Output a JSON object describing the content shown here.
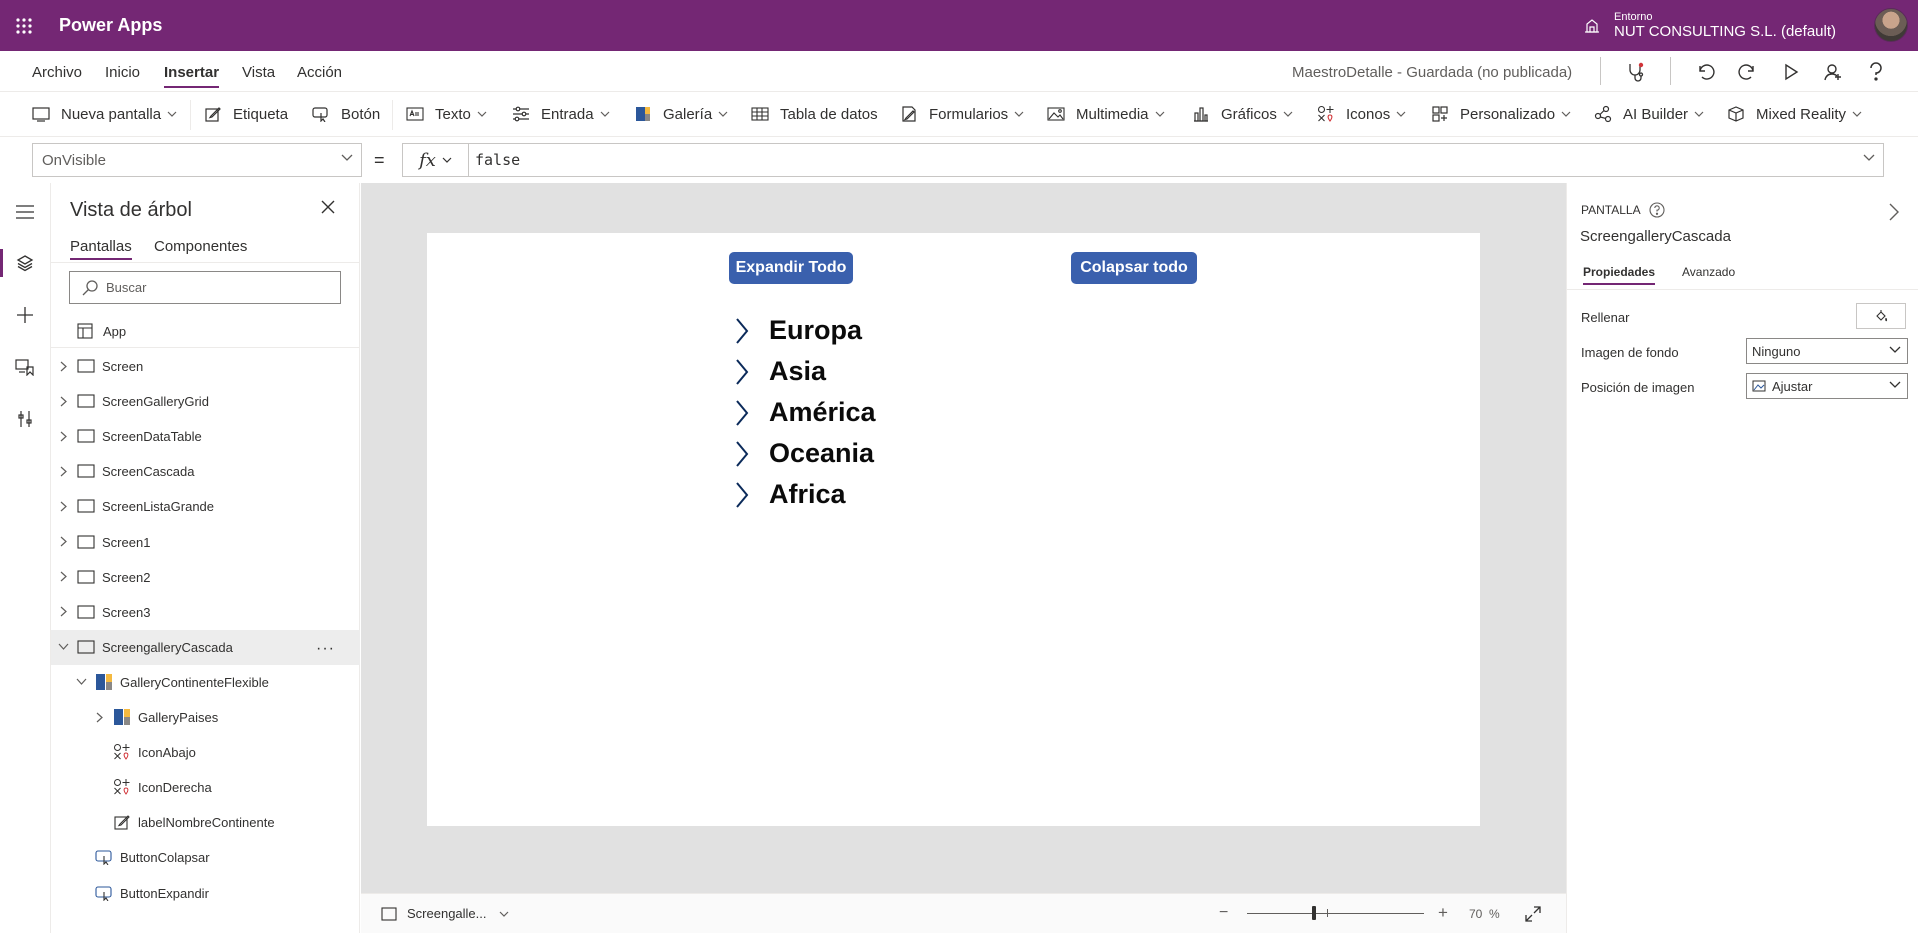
{
  "app": {
    "title": "Power Apps",
    "environment_label": "Entorno",
    "environment_name": "NUT CONSULTING S.L. (default)"
  },
  "menu": {
    "items": [
      "Archivo",
      "Inicio",
      "Insertar",
      "Vista",
      "Acción"
    ],
    "active": "Insertar",
    "save_status": "MaestroDetalle - Guardada (no publicada)"
  },
  "commands": [
    {
      "label": "Nueva pantalla",
      "icon": "new-screen-icon",
      "dropdown": true
    },
    {
      "label": "Etiqueta",
      "icon": "label-edit-icon",
      "dropdown": false
    },
    {
      "label": "Botón",
      "icon": "button-icon",
      "dropdown": false
    },
    {
      "label": "Texto",
      "icon": "text-icon",
      "dropdown": true
    },
    {
      "label": "Entrada",
      "icon": "input-icon",
      "dropdown": true
    },
    {
      "label": "Galería",
      "icon": "gallery-icon",
      "dropdown": true
    },
    {
      "label": "Tabla de datos",
      "icon": "table-icon",
      "dropdown": false
    },
    {
      "label": "Formularios",
      "icon": "forms-icon",
      "dropdown": true
    },
    {
      "label": "Multimedia",
      "icon": "image-icon",
      "dropdown": true
    },
    {
      "label": "Gráficos",
      "icon": "chart-icon",
      "dropdown": true
    },
    {
      "label": "Iconos",
      "icon": "icons-icon",
      "dropdown": true
    },
    {
      "label": "Personalizado",
      "icon": "custom-icon",
      "dropdown": true
    },
    {
      "label": "AI Builder",
      "icon": "ai-builder-icon",
      "dropdown": true
    },
    {
      "label": "Mixed Reality",
      "icon": "mixed-reality-icon",
      "dropdown": true
    }
  ],
  "formula": {
    "property": "OnVisible",
    "fx_label": "fx",
    "equals": "=",
    "value": "false"
  },
  "tree": {
    "title": "Vista de árbol",
    "tabs": [
      "Pantallas",
      "Componentes"
    ],
    "active_tab": "Pantallas",
    "search_placeholder": "Buscar",
    "app_node": "App",
    "nodes": [
      {
        "label": "Screen",
        "level": 0,
        "expander": "collapsed",
        "icon": "screen-icon"
      },
      {
        "label": "ScreenGalleryGrid",
        "level": 0,
        "expander": "collapsed",
        "icon": "screen-icon"
      },
      {
        "label": "ScreenDataTable",
        "level": 0,
        "expander": "collapsed",
        "icon": "screen-icon"
      },
      {
        "label": "ScreenCascada",
        "level": 0,
        "expander": "collapsed",
        "icon": "screen-icon"
      },
      {
        "label": "ScreenListaGrande",
        "level": 0,
        "expander": "collapsed",
        "icon": "screen-icon"
      },
      {
        "label": "Screen1",
        "level": 0,
        "expander": "collapsed",
        "icon": "screen-icon"
      },
      {
        "label": "Screen2",
        "level": 0,
        "expander": "collapsed",
        "icon": "screen-icon"
      },
      {
        "label": "Screen3",
        "level": 0,
        "expander": "collapsed",
        "icon": "screen-icon"
      },
      {
        "label": "ScreengalleryCascada",
        "level": 0,
        "expander": "expanded",
        "icon": "screen-icon",
        "selected": true
      },
      {
        "label": "GalleryContinenteFlexible",
        "level": 1,
        "expander": "expanded",
        "icon": "gallery-icon"
      },
      {
        "label": "GalleryPaises",
        "level": 2,
        "expander": "collapsed",
        "icon": "gallery-icon"
      },
      {
        "label": "IconAbajo",
        "level": 2,
        "expander": "none",
        "icon": "icon-control-icon"
      },
      {
        "label": "IconDerecha",
        "level": 2,
        "expander": "none",
        "icon": "icon-control-icon"
      },
      {
        "label": "labelNombreContinente",
        "level": 2,
        "expander": "none",
        "icon": "label-edit-icon"
      },
      {
        "label": "ButtonColapsar",
        "level": 1,
        "expander": "none",
        "icon": "button-icon"
      },
      {
        "label": "ButtonExpandir",
        "level": 1,
        "expander": "none",
        "icon": "button-icon"
      }
    ]
  },
  "canvas": {
    "expand_button": "Expandir Todo",
    "collapse_button": "Colapsar todo",
    "continents": [
      "Europa",
      "Asia",
      "América",
      "Oceania",
      "Africa"
    ],
    "button_color": "#3a60ad"
  },
  "bottom": {
    "screen_name": "Screengalle...",
    "zoom_value": "70",
    "zoom_unit": "%",
    "zoom_minus": "−",
    "zoom_plus": "+"
  },
  "properties": {
    "kicker": "PANTALLA",
    "name": "ScreengalleryCascada",
    "tabs": [
      "Propiedades",
      "Avanzado"
    ],
    "active_tab": "Propiedades",
    "fill_label": "Rellenar",
    "bg_image_label": "Imagen de fondo",
    "bg_image_value": "Ninguno",
    "image_pos_label": "Posición de imagen",
    "image_pos_value": "Ajustar"
  },
  "colors": {
    "brand": "#742774",
    "accent_button": "#3a60ad"
  }
}
